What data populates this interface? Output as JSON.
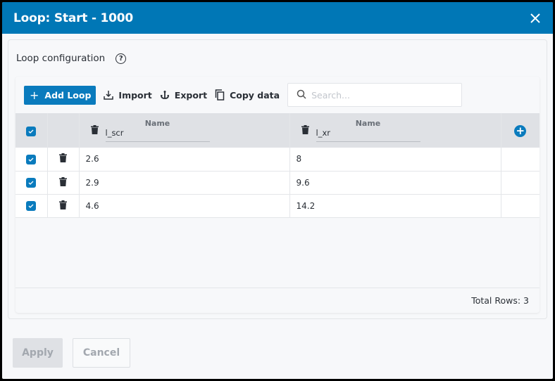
{
  "dialog": {
    "title": "Loop: Start - 1000",
    "close_icon": "close-icon"
  },
  "panel": {
    "heading": "Loop configuration",
    "help_icon": "?"
  },
  "toolbar": {
    "add_label": "Add Loop",
    "import_label": "Import",
    "export_label": "Export",
    "copy_label": "Copy data",
    "search_placeholder": "Search..."
  },
  "table": {
    "columns": [
      {
        "label": "Name",
        "value": "l_scr"
      },
      {
        "label": "Name",
        "value": "l_xr"
      }
    ],
    "rows": [
      {
        "checked": true,
        "values": [
          "2.6",
          "8"
        ]
      },
      {
        "checked": true,
        "values": [
          "2.9",
          "9.6"
        ]
      },
      {
        "checked": true,
        "values": [
          "4.6",
          "14.2"
        ]
      }
    ],
    "total_rows": "Total Rows: 3"
  },
  "actions": {
    "apply_label": "Apply",
    "cancel_label": "Cancel"
  }
}
